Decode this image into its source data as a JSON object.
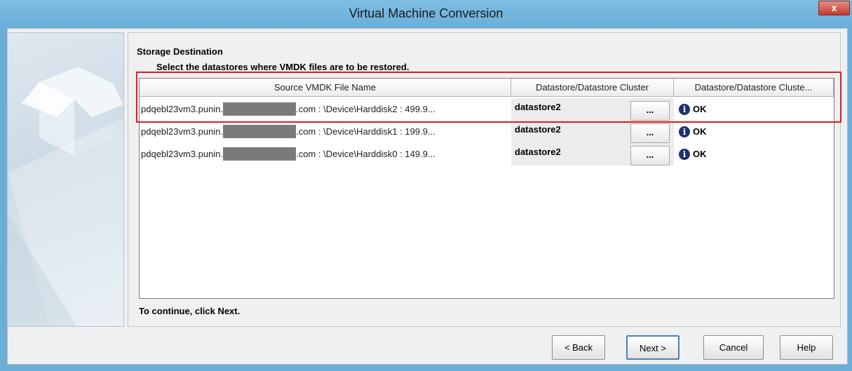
{
  "window": {
    "title": "Virtual Machine Conversion",
    "close_label": "x"
  },
  "section": {
    "title": "Storage Destination",
    "subtitle": "Select the datastores where VMDK files are to be restored."
  },
  "table": {
    "headers": [
      "Source VMDK File Name",
      "Datastore/Datastore Cluster",
      "Datastore/Datastore Cluste..."
    ],
    "rows": [
      {
        "src_prefix": "pdqebl23vm3.punin.",
        "src_suffix": ".com : \\Device\\Harddisk2 : 499.9...",
        "datastore": "datastore2",
        "browse": "...",
        "status": "OK"
      },
      {
        "src_prefix": "pdqebl23vm3.punin.",
        "src_suffix": ".com : \\Device\\Harddisk1 : 199.9...",
        "datastore": "datastore2",
        "browse": "...",
        "status": "OK"
      },
      {
        "src_prefix": "pdqebl23vm3.punin.",
        "src_suffix": ".com : \\Device\\Harddisk0 : 149.9...",
        "datastore": "datastore2",
        "browse": "...",
        "status": "OK"
      }
    ]
  },
  "footer_text": "To continue, click Next.",
  "buttons": {
    "back": "< Back",
    "next": "Next >",
    "cancel": "Cancel",
    "help": "Help"
  },
  "icons": {
    "status": "info-icon",
    "close": "close-icon"
  },
  "colors": {
    "titlebar": "#6aaed8",
    "highlight": "#e01c24",
    "close": "#c7392c"
  }
}
